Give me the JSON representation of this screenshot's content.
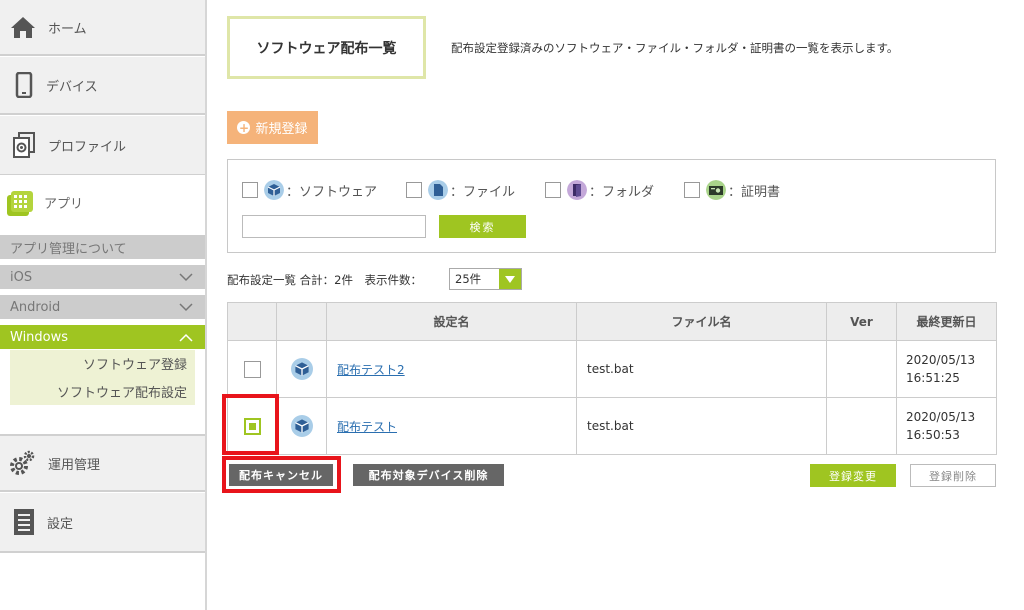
{
  "sidebar": {
    "home": "ホーム",
    "device": "デバイス",
    "profile": "プロファイル",
    "app": "アプリ",
    "app_about": "アプリ管理について",
    "ios": "iOS",
    "android": "Android",
    "windows": "Windows",
    "sw_register": "ソフトウェア登録",
    "sw_distribution": "ソフトウェア配布設定",
    "operation": "運用管理",
    "settings": "設定"
  },
  "page": {
    "title": "ソフトウェア配布一覧",
    "description": "配布設定登録済みのソフトウェア・ファイル・フォルダ・証明書の一覧を表示します。",
    "new_button": "新規登録"
  },
  "filter": {
    "software": "：ソフトウェア",
    "file": "：ファイル",
    "folder": "：フォルダ",
    "certificate": "：証明書",
    "search_button": "検索",
    "search_value": ""
  },
  "list": {
    "info": "配布設定一覧 合計：2件　表示件数：",
    "page_size": "25件",
    "columns": {
      "name": "設定名",
      "file": "ファイル名",
      "ver": "Ver",
      "updated": "最終更新日"
    },
    "rows": [
      {
        "name": "配布テスト2",
        "file": "test.bat",
        "ver": "",
        "date": "2020/05/13",
        "time": "16:51:25",
        "checked": false
      },
      {
        "name": "配布テスト",
        "file": "test.bat",
        "ver": "",
        "date": "2020/05/13",
        "time": "16:50:53",
        "checked": true
      }
    ]
  },
  "actions": {
    "cancel_distribution": "配布キャンセル",
    "delete_devices": "配布対象デバイス削除",
    "change_registration": "登録変更",
    "delete_registration": "登録削除"
  },
  "colors": {
    "accent_green": "#9fc521",
    "new_button": "#f5b37a",
    "highlight_red": "#e8141b"
  }
}
